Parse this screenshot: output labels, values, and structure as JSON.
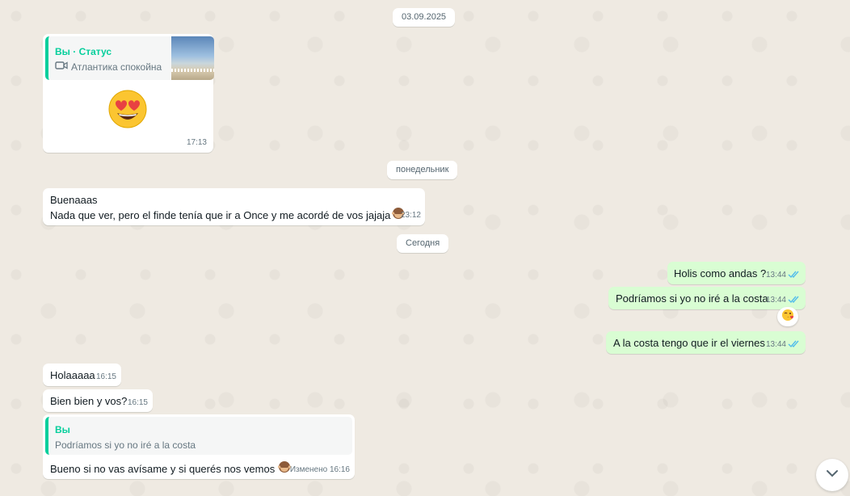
{
  "chips": {
    "date1": "03.09.2025",
    "monday": "понедельник",
    "today": "Сегодня"
  },
  "status_reply": {
    "author": "Вы · Статус",
    "caption": "Атлантика спокойна",
    "time": "17:13"
  },
  "msg_buenaaas": {
    "line1": "Buenaaas",
    "line2": "Nada que ver, pero el finde tenía que ir a Once y me acordé de vos jajaja",
    "time": "23:12"
  },
  "out_messages": [
    {
      "text": "Holis como andas ?",
      "time": "13:44"
    },
    {
      "text": "Podríamos si yo no iré a la costa",
      "time": "13:44"
    },
    {
      "text": "A la costa tengo que ir el viernes",
      "time": "13:44"
    }
  ],
  "in_messages": [
    {
      "text": "Holaaaaa",
      "time": "16:15"
    },
    {
      "text": "Bien bien y vos?",
      "time": "16:15"
    }
  ],
  "reply_msg": {
    "quote_author": "Вы",
    "quote_text": "Podríamos si yo no iré a la costa",
    "text": "Bueno si no vas avísame y si querés nos vemos",
    "edited_time": "Изменено 16:16"
  },
  "colors": {
    "accent": "#06cf9c",
    "outgoing_bubble": "#d9fdd3",
    "read_ticks": "#53bdeb"
  }
}
